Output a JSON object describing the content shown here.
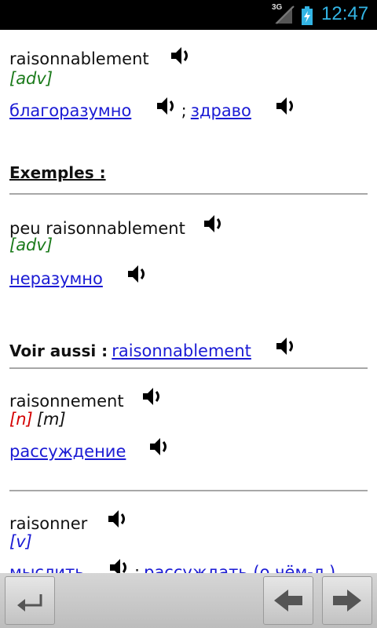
{
  "status": {
    "network": "3G",
    "time": "12:47"
  },
  "entries": [
    {
      "term": "raisonnablement",
      "pos": "[adv]",
      "translation1": "благоразумно",
      "separator": ";",
      "translation2": "здраво"
    }
  ],
  "examples": {
    "title": "Exemples :",
    "term": "peu raisonnablement",
    "pos": "[adv]",
    "translation": "неразумно"
  },
  "see_also": {
    "label": "Voir aussi :",
    "link": "raisonnablement"
  },
  "entry2": {
    "term": "raisonnement",
    "pos1": "[n]",
    "pos2": "[m]",
    "translation": "рассуждение"
  },
  "entry3": {
    "term": "raisonner",
    "pos": "[v]",
    "translation1": "мыслить",
    "separator": ";",
    "translation2": "рассуждать (о чём-л.)"
  },
  "colors": {
    "link": "#1a1ad4",
    "adverb_tag": "#1a7a1a",
    "noun_tag": "#d40000",
    "verb_tag": "#1a1ad4",
    "status_accent": "#33b5e5"
  },
  "icons": [
    "back-icon",
    "arrow-left-icon",
    "arrow-right-icon",
    "speaker-icon"
  ]
}
